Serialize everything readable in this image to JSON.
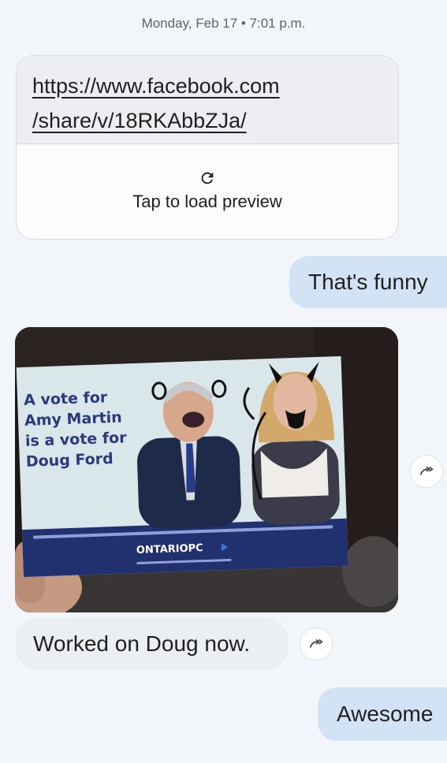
{
  "conversation": {
    "timestamp": "Monday, Feb 17 • 7:01 p.m."
  },
  "link_preview": {
    "url_line_1": "https://www.facebook.com",
    "url_line_2": "/share/v/18RKAbbZJa/",
    "load_label": "Tap to load preview",
    "icon": "refresh-icon"
  },
  "messages": {
    "outgoing_1": "That's funny",
    "incoming_text": "Worked on Doug now.",
    "outgoing_2": "Awesome"
  },
  "photo": {
    "flyer_headline": [
      "A vote for",
      "Amy Martin",
      "is a vote for",
      "Doug Ford"
    ],
    "flyer_brand": "ONTARIOPC"
  },
  "icons": {
    "forward": "forward-share-icon"
  },
  "colors": {
    "outgoing_bubble": "#d3e3f6",
    "incoming_bubble": "#ebeef3",
    "flyer_navy": "#2a3a7c"
  }
}
